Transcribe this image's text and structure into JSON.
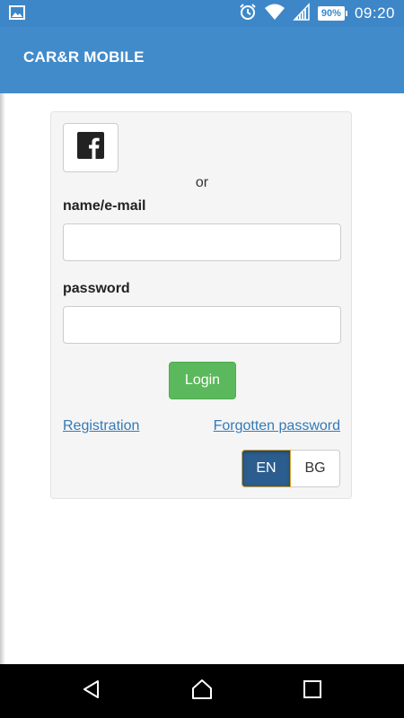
{
  "status_bar": {
    "battery": "90%",
    "time": "09:20",
    "icons": [
      "image-icon",
      "alarm-icon",
      "wifi-icon",
      "signal-icon",
      "battery-icon"
    ]
  },
  "app_bar": {
    "title": "CAR&R MOBILE"
  },
  "login": {
    "facebook_icon": "facebook-icon",
    "or_text": "or",
    "name_label": "name/e-mail",
    "name_value": "",
    "password_label": "password",
    "password_value": "",
    "login_label": "Login",
    "registration_link": "Registration",
    "forgot_link": "Forgotten password",
    "languages": [
      "EN",
      "BG"
    ],
    "selected_language": "EN"
  },
  "nav_bar": {
    "icons": [
      "back-icon",
      "home-icon",
      "recents-icon"
    ]
  },
  "colors": {
    "status_bar": "#3d87c9",
    "app_bar": "#428bca",
    "login_button": "#5cb85c",
    "link": "#337ab7",
    "lang_selected": "#2b5d8f"
  }
}
